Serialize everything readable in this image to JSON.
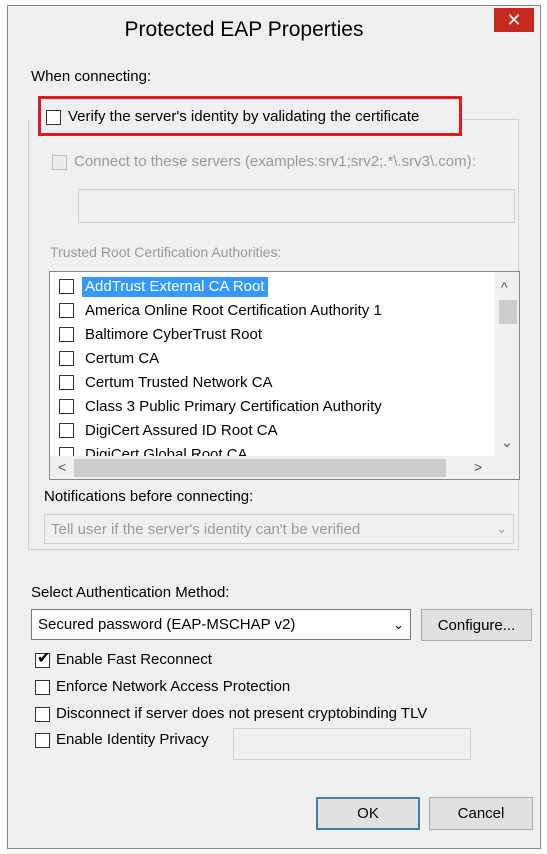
{
  "window": {
    "title": "Protected EAP Properties",
    "close_glyph": "✕"
  },
  "when_connecting_label": "When connecting:",
  "verify_server": {
    "label": "Verify the server's identity by validating the certificate",
    "checked": false
  },
  "connect_servers": {
    "label": "Connect to these servers (examples:srv1;srv2;.*\\.srv3\\.com):",
    "checked": false,
    "value": ""
  },
  "trusted_root_label": "Trusted Root Certification Authorities:",
  "trusted_roots": [
    {
      "label": "AddTrust External CA Root",
      "checked": false,
      "selected": true
    },
    {
      "label": "America Online Root Certification Authority 1",
      "checked": false,
      "selected": false
    },
    {
      "label": "Baltimore CyberTrust Root",
      "checked": false,
      "selected": false
    },
    {
      "label": "Certum CA",
      "checked": false,
      "selected": false
    },
    {
      "label": "Certum Trusted Network CA",
      "checked": false,
      "selected": false
    },
    {
      "label": "Class 3 Public Primary Certification Authority",
      "checked": false,
      "selected": false
    },
    {
      "label": "DigiCert Assured ID Root CA",
      "checked": false,
      "selected": false
    },
    {
      "label": "DigiCert Global Root CA",
      "checked": false,
      "selected": false
    }
  ],
  "scroll": {
    "up": "^",
    "down": "⌄",
    "left": "<",
    "right": ">"
  },
  "notifications_label": "Notifications before connecting:",
  "notifications_value": "Tell user if the server's identity can't be verified",
  "auth_method_label": "Select Authentication Method:",
  "auth_method_value": "Secured password (EAP-MSCHAP v2)",
  "dropdown_glyph": "⌄",
  "configure_label": "Configure...",
  "options": {
    "fast_reconnect": {
      "label": "Enable Fast Reconnect",
      "checked": true
    },
    "nap": {
      "label": "Enforce Network Access Protection",
      "checked": false
    },
    "cryptobinding": {
      "label": "Disconnect if server does not present cryptobinding TLV",
      "checked": false
    },
    "identity_privacy": {
      "label": "Enable Identity Privacy",
      "checked": false,
      "value": ""
    }
  },
  "check_glyph": "✔",
  "ok_label": "OK",
  "cancel_label": "Cancel"
}
